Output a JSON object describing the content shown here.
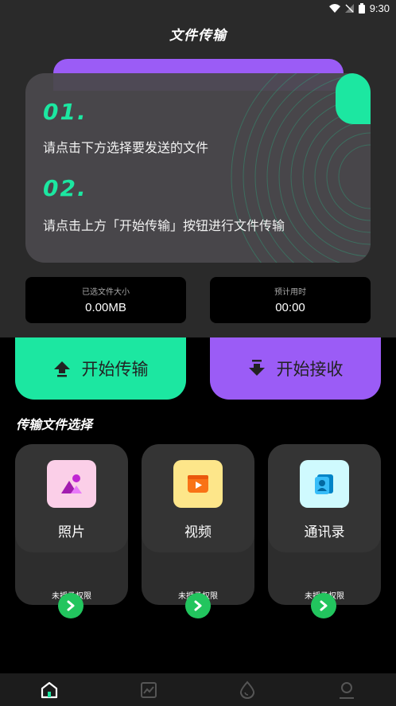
{
  "status_bar": {
    "time": "9:30"
  },
  "title": "文件传输",
  "steps": [
    {
      "num": "01.",
      "text": "请点击下方选择要发送的文件"
    },
    {
      "num": "02.",
      "text": "请点击上方「开始传输」按钮进行文件传输"
    }
  ],
  "stats": {
    "size_label": "已选文件大小",
    "size_value": "0.00MB",
    "time_label": "预计用时",
    "time_value": "00:00"
  },
  "buttons": {
    "send": "开始传输",
    "receive": "开始接收"
  },
  "section_title": "传输文件选择",
  "file_types": [
    {
      "name": "照片",
      "permission": "未授予权限",
      "icon": "photo-icon"
    },
    {
      "name": "视频",
      "permission": "未授予权限",
      "icon": "video-icon"
    },
    {
      "name": "通讯录",
      "permission": "未授予权限",
      "icon": "contacts-icon"
    }
  ],
  "nav": [
    "home-icon",
    "chart-icon",
    "drop-icon",
    "profile-icon"
  ],
  "colors": {
    "green": "#1ce7a1",
    "purple": "#9b5cf6",
    "go": "#22c55e"
  }
}
